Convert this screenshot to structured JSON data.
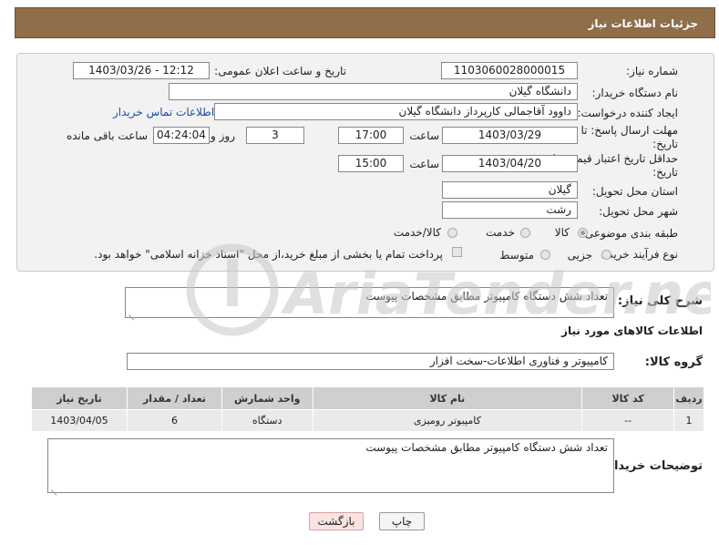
{
  "header": {
    "title": "جزئیات اطلاعات نیاز"
  },
  "form": {
    "need_number_label": "شماره نیاز:",
    "need_number": "1103060028000015",
    "announce_label": "تاریخ و ساعت اعلان عمومی:",
    "announce_value": "1403/03/26 - 12:12",
    "buyer_org_label": "نام دستگاه خریدار:",
    "buyer_org": "دانشگاه گیلان",
    "creator_label": "ایجاد کننده درخواست:",
    "creator": "داوود  آقاجمالی کارپرداز دانشگاه گیلان",
    "contact_link": "اطلاعات تماس خریدار",
    "deadline_label_1": "مهلت ارسال پاسخ: تا",
    "deadline_label_2": "تاریخ:",
    "deadline_date": "1403/03/29",
    "hour_label": "ساعت",
    "deadline_time": "17:00",
    "days_value": "3",
    "day_and_label": "روز و",
    "remaining_time": "04:24:04",
    "remaining_label": "ساعت باقی مانده",
    "validity_label_1": "حداقل تاریخ اعتبار قیمت: تا",
    "validity_label_2": "تاریخ:",
    "validity_date": "1403/04/20",
    "validity_hour_label": "ساعت",
    "validity_time": "15:00",
    "province_label": "استان محل تحویل:",
    "province": "گیلان",
    "city_label": "شهر محل تحویل:",
    "city": "رشت",
    "category_label": "طبقه بندی موضوعی:",
    "category_options": [
      "کالا",
      "خدمت",
      "کالا/خدمت"
    ],
    "category_selected": "کالا",
    "process_label": "نوع فرآیند خرید :",
    "process_options": [
      "جزیی",
      "متوسط"
    ],
    "payment_note": "پرداخت تمام یا بخشی از مبلغ خرید،از محل \"اسناد خزانه اسلامی\" خواهد بود."
  },
  "summary": {
    "label": "شرح کلی نیاز:",
    "text": "تعداد شش دستگاه کامپیوتر مطابق مشخصات پیوست"
  },
  "goods_section": {
    "title": "اطلاعات کالاهای مورد نیاز",
    "group_label": "گروه کالا:",
    "group_value": "کامپیوتر و فناوری اطلاعات-سخت افزار"
  },
  "table": {
    "headers": [
      "ردیف",
      "کد کالا",
      "نام کالا",
      "واحد شمارش",
      "تعداد / مقدار",
      "تاریخ نیاز"
    ],
    "rows": [
      [
        "1",
        "--",
        "کامپیوتر رومیزی",
        "دستگاه",
        "6",
        "1403/04/05"
      ]
    ]
  },
  "buyer_notes": {
    "label": "توضیحات خریدار:",
    "text": "تعداد شش دستگاه کامپیوتر مطابق مشخصات پیوست"
  },
  "buttons": {
    "print": "چاپ",
    "back": "بازگشت"
  },
  "watermark": {
    "text": "AriaTender.net"
  }
}
